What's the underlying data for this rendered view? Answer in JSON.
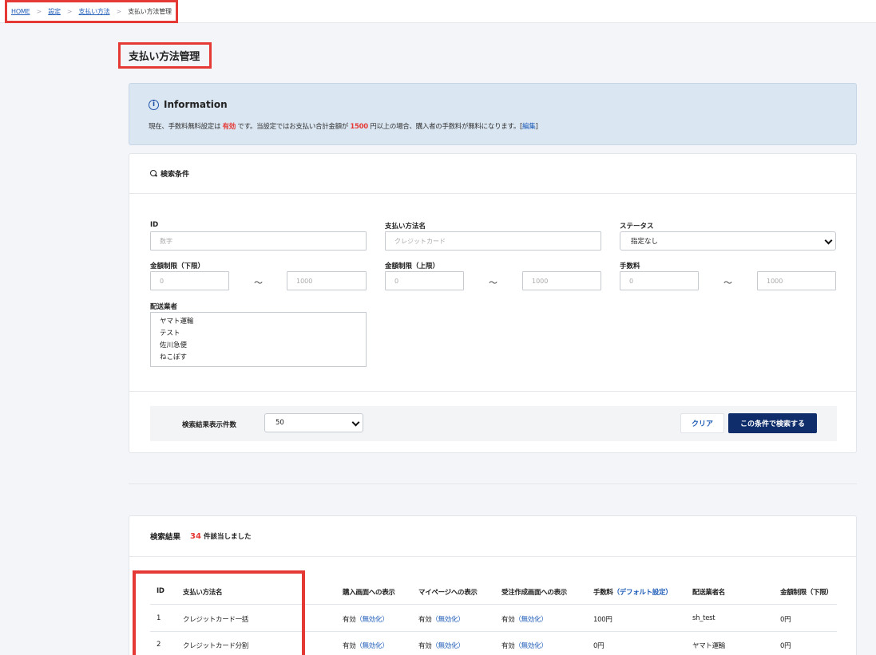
{
  "breadcrumb": {
    "home": "HOME",
    "settings": "設定",
    "payment": "支払い方法",
    "current": "支払い方法管理",
    "sep": ">"
  },
  "page_title": "支払い方法管理",
  "info": {
    "title": "Information",
    "t1": "現在、手数料無料設定は",
    "status": "有効",
    "t2": "です。当設定ではお支払い合計金額が",
    "amount": "1500",
    "t3": "円以上の場合、購入者の手数料が無料になります。[",
    "edit": "編集",
    "t4": "]"
  },
  "search": {
    "header": "検索条件",
    "id_label": "ID",
    "id_placeholder": "数字",
    "name_label": "支払い方法名",
    "name_placeholder": "クレジットカード",
    "status_label": "ステータス",
    "status_value": "指定なし",
    "min_label": "金額制限（下限）",
    "max_label": "金額制限（上限）",
    "fee_label": "手数料",
    "from_placeholder": "0",
    "to_placeholder": "1000",
    "tilde": "～",
    "carrier_label": "配送業者",
    "carriers": [
      "ヤマト運輸",
      "テスト",
      "佐川急便",
      "ねこぽす"
    ],
    "per_page_label": "検索結果表示件数",
    "per_page_value": "50",
    "clear_button": "クリア",
    "search_button": "この条件で検索する"
  },
  "results": {
    "title": "検索結果",
    "count": "34",
    "suffix": "件該当しました",
    "columns": [
      "ID",
      "支払い方法名",
      "購入画面への表示",
      "マイページへの表示",
      "受注作成画面への表示",
      "手数料",
      "（デフォルト設定）",
      "配送業者名",
      "金額制限（下限）"
    ],
    "rows": [
      {
        "id": "1",
        "name": "クレジットカード一括",
        "purchase": "有効",
        "mypage": "有効",
        "order": "有効",
        "toggle": "（無効化）",
        "fee": "100円",
        "carrier": "sh_test",
        "min": "0円"
      },
      {
        "id": "2",
        "name": "クレジットカード分割",
        "purchase": "有効",
        "mypage": "有効",
        "order": "有効",
        "toggle": "（無効化）",
        "fee": "0円",
        "carrier": "ヤマト運輸",
        "min": "0円"
      }
    ]
  },
  "colors": {
    "accent": "#e53935",
    "navy": "#0f2d6b",
    "link": "#1f5db8"
  }
}
